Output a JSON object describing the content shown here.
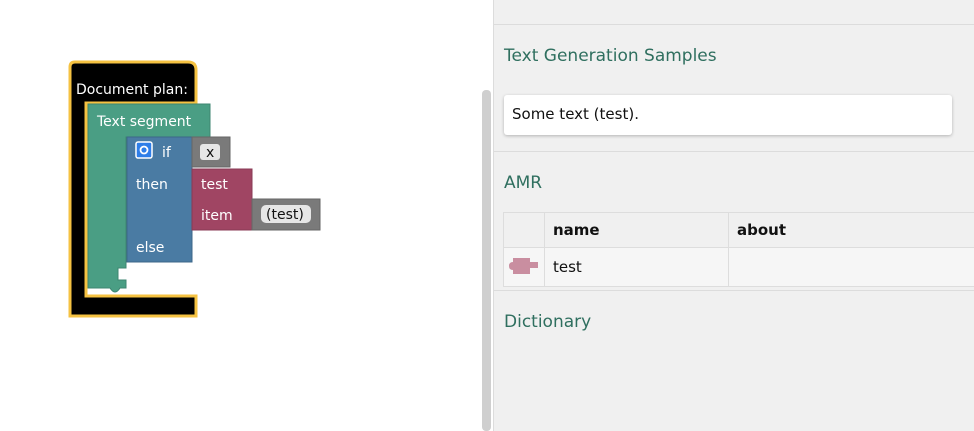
{
  "workspace": {
    "document_plan_label": "Document plan:",
    "segment_label": "Text segment",
    "if_label": "if",
    "condition_value": "x",
    "then_label": "then",
    "else_label": "else",
    "amr_block_label": "test",
    "item_label": "item",
    "item_value": "(test)"
  },
  "panel": {
    "samples": {
      "title": "Text Generation Samples",
      "items": [
        "Some text (test)."
      ]
    },
    "amr": {
      "title": "AMR",
      "columns": [
        "",
        "name",
        "about"
      ],
      "rows": [
        {
          "icon": "puzzle-piece-icon",
          "name": "test",
          "about": ""
        }
      ]
    },
    "dictionary": {
      "title": "Dictionary"
    }
  },
  "colors": {
    "document_plan": "#000000",
    "highlight": "#f5c242",
    "segment": "#4a9e84",
    "if_block": "#4a7ba3",
    "condition": "#7a7a7a",
    "amr_block": "#a04563",
    "section_title": "#2f6f5f",
    "amr_icon": "#c98ea0"
  }
}
